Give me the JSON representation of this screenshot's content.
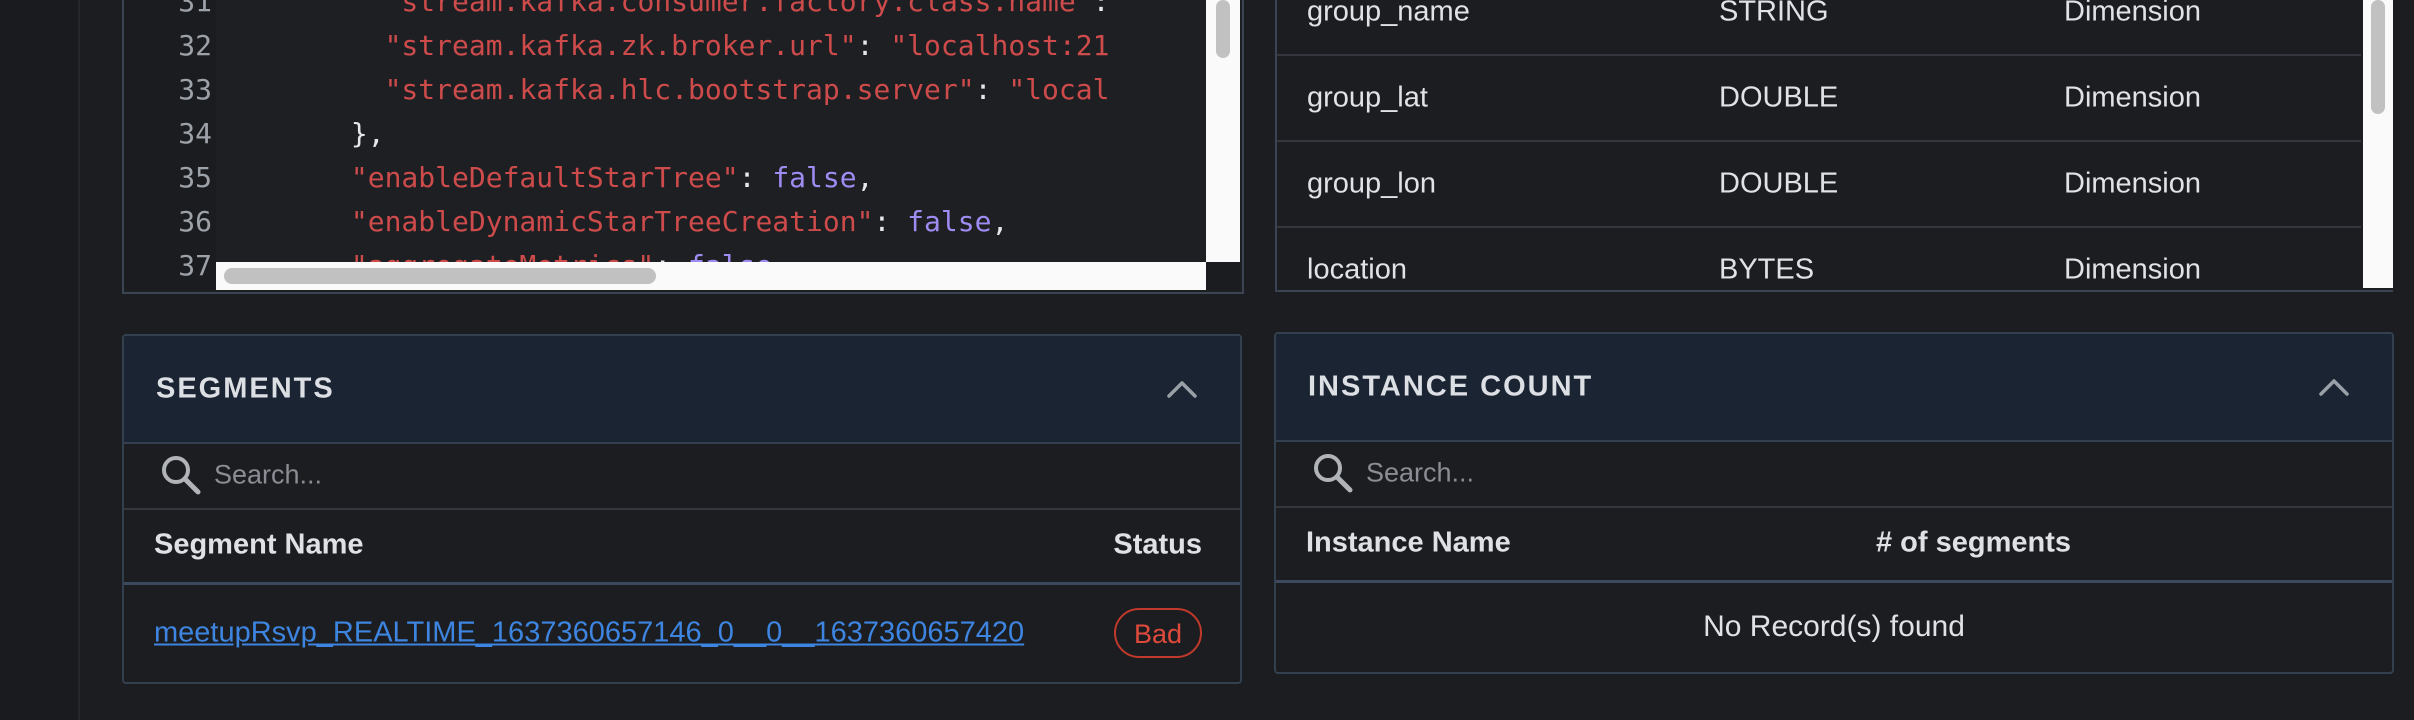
{
  "config_editor": {
    "lines": [
      {
        "num": "31",
        "indent": "          ",
        "key": "\"stream.kafka.consumer.factory.class.name\"",
        "sep": ": ",
        "val": "",
        "val_type": "string",
        "tail": ""
      },
      {
        "num": "32",
        "indent": "          ",
        "key": "\"stream.kafka.zk.broker.url\"",
        "sep": ": ",
        "val": "\"localhost:21",
        "val_type": "string",
        "tail": ""
      },
      {
        "num": "33",
        "indent": "          ",
        "key": "\"stream.kafka.hlc.bootstrap.server\"",
        "sep": ": ",
        "val": "\"local",
        "val_type": "string",
        "tail": ""
      },
      {
        "num": "34",
        "indent": "        ",
        "key": "",
        "sep": "},",
        "val": "",
        "val_type": "string",
        "tail": ""
      },
      {
        "num": "35",
        "indent": "        ",
        "key": "\"enableDefaultStarTree\"",
        "sep": ": ",
        "val": "false",
        "val_type": "bool",
        "tail": ","
      },
      {
        "num": "36",
        "indent": "        ",
        "key": "\"enableDynamicStarTreeCreation\"",
        "sep": ": ",
        "val": "false",
        "val_type": "bool",
        "tail": ","
      },
      {
        "num": "37",
        "indent": "        ",
        "key": "\"aggregateMetrics\"",
        "sep": ": ",
        "val": "false",
        "val_type": "bool",
        "tail": ","
      }
    ]
  },
  "schema_table": {
    "rows": [
      {
        "name": "group_name",
        "type": "STRING",
        "field_type": "Dimension"
      },
      {
        "name": "group_lat",
        "type": "DOUBLE",
        "field_type": "Dimension"
      },
      {
        "name": "group_lon",
        "type": "DOUBLE",
        "field_type": "Dimension"
      },
      {
        "name": "location",
        "type": "BYTES",
        "field_type": "Dimension"
      }
    ]
  },
  "segments": {
    "title": "SEGMENTS",
    "search_placeholder": "Search...",
    "columns": {
      "name": "Segment Name",
      "status": "Status"
    },
    "rows": [
      {
        "name": "meetupRsvp_REALTIME_1637360657146_0__0__1637360657420",
        "status": "Bad"
      }
    ]
  },
  "instance_count": {
    "title": "INSTANCE COUNT",
    "search_placeholder": "Search...",
    "columns": {
      "name": "Instance Name",
      "segments": "# of segments"
    },
    "empty_message": "No Record(s) found"
  },
  "colors": {
    "background": "#1c1d20",
    "card_header": "#1b2432",
    "border": "#33404f",
    "json_key": "#ce4b4b",
    "json_bool": "#9f8cf2",
    "link": "#3d85e0",
    "status_bad": "#e04a3d"
  }
}
